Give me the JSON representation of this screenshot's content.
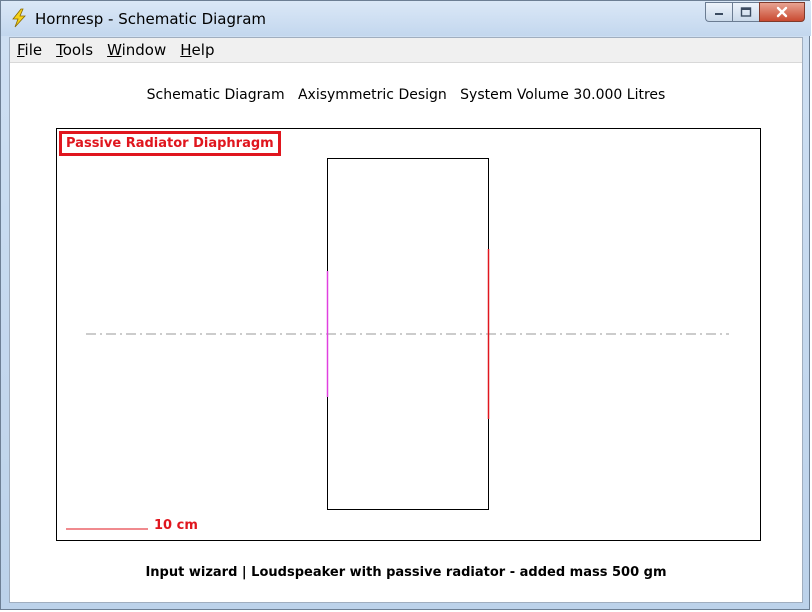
{
  "window": {
    "title": "Hornresp - Schematic Diagram",
    "app_icon": "lightning-bolt-icon",
    "accent_color": "#e0161e"
  },
  "menu": {
    "file": "File",
    "tools": "Tools",
    "window": "Window",
    "help": "Help"
  },
  "diagram": {
    "header_title": "Schematic Diagram",
    "header_design": "Axisymmetric Design",
    "header_volume": "System Volume 30.000 Litres",
    "selected_component": "Passive Radiator Diaphragm",
    "scale_label": "10 cm",
    "colors": {
      "outline": "#000000",
      "highlight": "#e0161e",
      "driver": "#e040e0",
      "axis": "#9a9a9a"
    }
  },
  "status": {
    "footer": "Input wizard | Loudspeaker with passive radiator - added mass 500 gm"
  }
}
